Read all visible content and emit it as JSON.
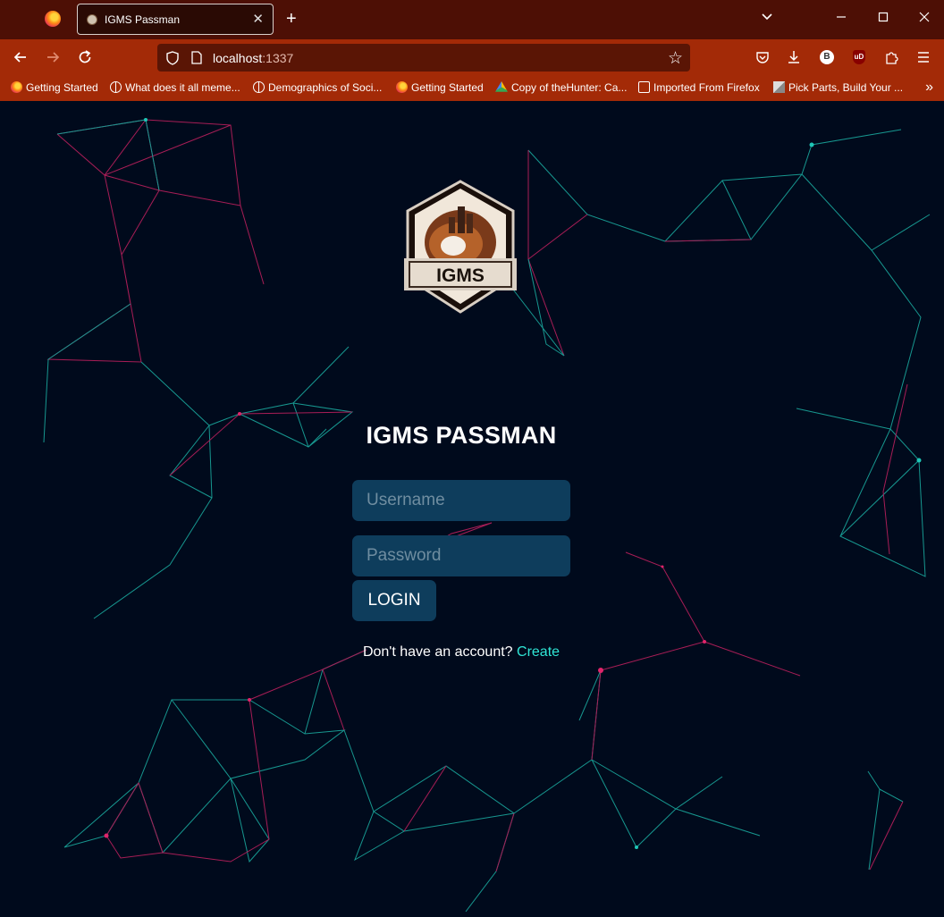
{
  "browser": {
    "tab": {
      "title": "IGMS Passman"
    },
    "url": {
      "host": "localhost",
      "port": ":1337"
    },
    "extensions": {
      "bitwarden": "B",
      "ublock": "uD"
    },
    "bookmarks": [
      {
        "label": "Getting Started",
        "icon": "firefox-icon"
      },
      {
        "label": "What does it all meme...",
        "icon": "globe-icon"
      },
      {
        "label": "Demographics of Soci...",
        "icon": "globe-icon"
      },
      {
        "label": "Getting Started",
        "icon": "firefox-icon"
      },
      {
        "label": "Copy of theHunter: Ca...",
        "icon": "google-drive-icon"
      },
      {
        "label": "Imported From Firefox",
        "icon": "folder-icon"
      },
      {
        "label": "Pick Parts, Build Your ...",
        "icon": "pcpartpicker-icon"
      }
    ]
  },
  "login": {
    "logo_text": "IGMS",
    "title": "IGMS PASSMAN",
    "username_placeholder": "Username",
    "password_placeholder": "Password",
    "login_label": "LOGIN",
    "signup_prompt": "Don't have an account?",
    "signup_link": "Create"
  },
  "colors": {
    "page_bg": "#000a1c",
    "field_bg": "#0e3d5c",
    "link": "#2fe6d6",
    "line_teal": "#1fc6b6",
    "line_pink": "#e0246a",
    "tabbar": "#4d0f05",
    "toolbar": "#a32a07"
  }
}
